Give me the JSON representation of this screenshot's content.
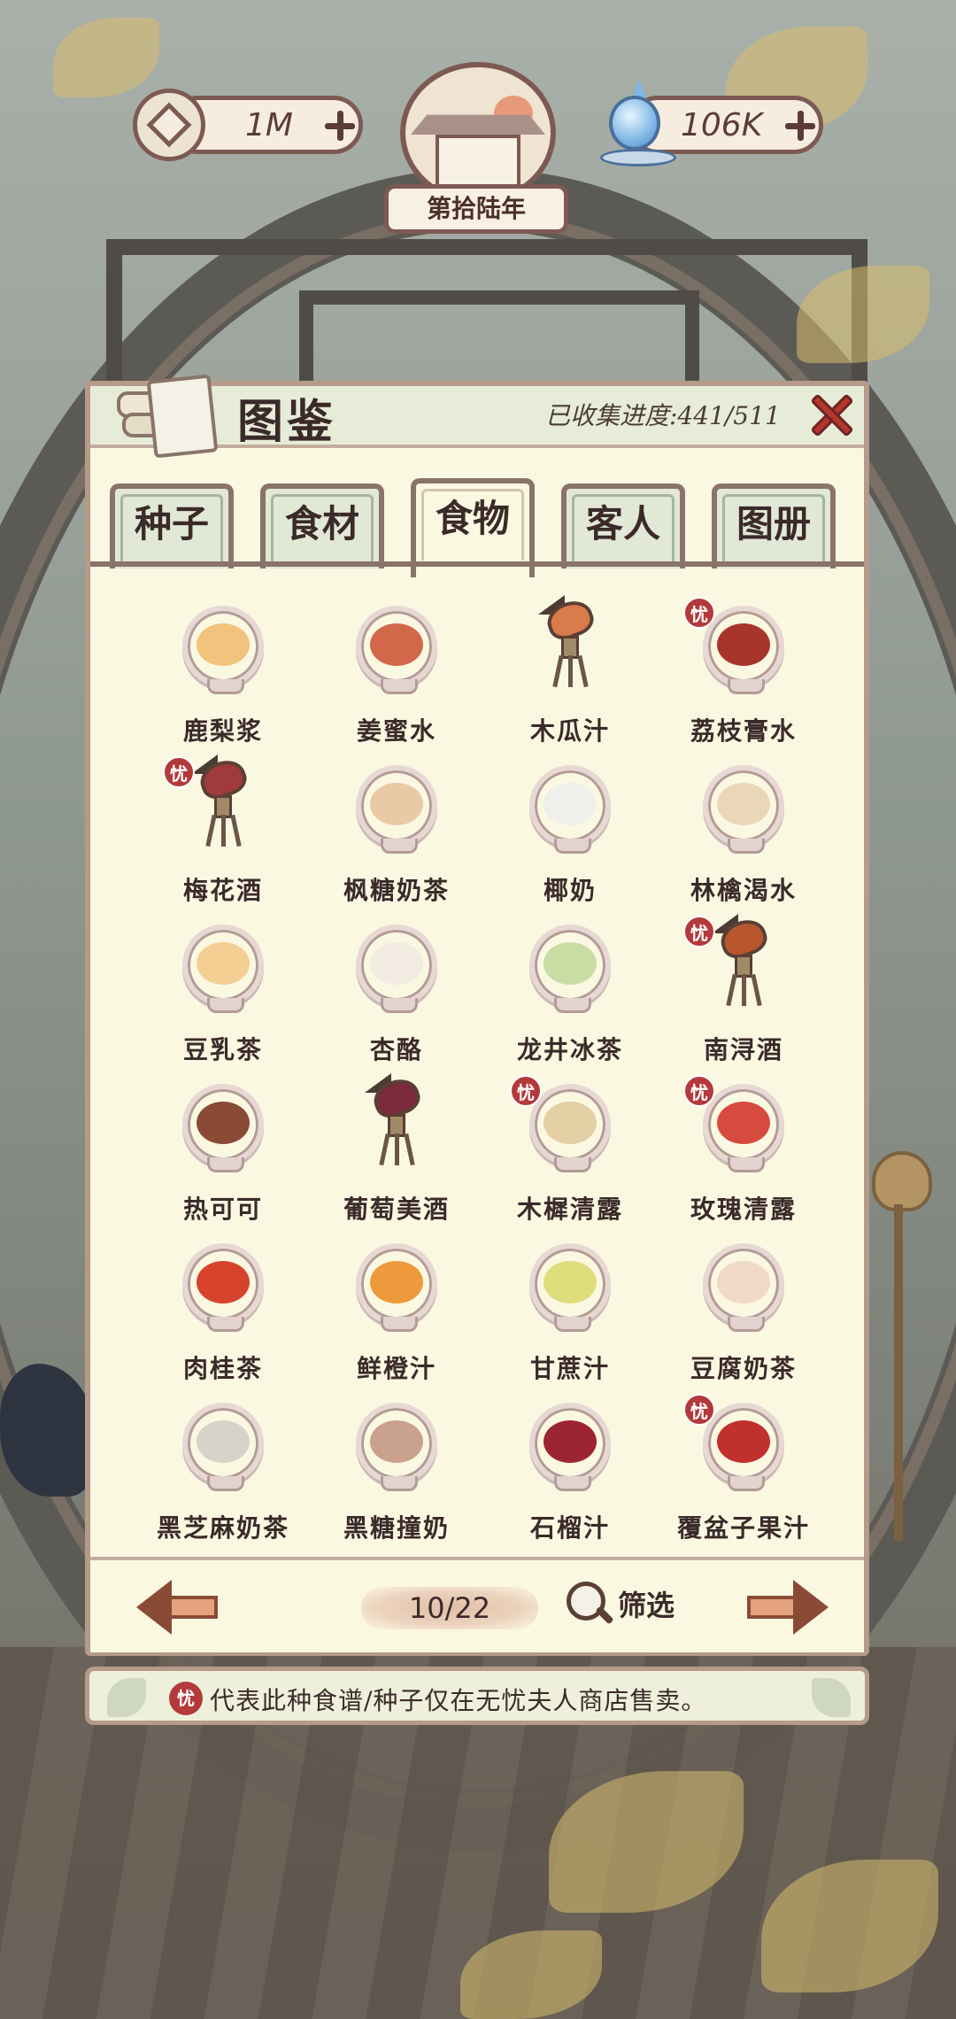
{
  "hud": {
    "coins": "1M",
    "water": "106K",
    "year": "第拾陆年"
  },
  "panel": {
    "title": "图鉴",
    "progress": "已收集进度:441/511"
  },
  "tabs": [
    {
      "label": "种子"
    },
    {
      "label": "食材"
    },
    {
      "label": "食物"
    },
    {
      "label": "客人"
    },
    {
      "label": "图册"
    }
  ],
  "active_tab": "食物",
  "items": [
    {
      "name": "鹿梨浆",
      "icon": "cup",
      "liquid": "#f2c37c",
      "exclusive": false
    },
    {
      "name": "姜蜜水",
      "icon": "cup",
      "liquid": "#d2674a",
      "exclusive": false
    },
    {
      "name": "木瓜汁",
      "icon": "jue",
      "liquid": "#d97b4a",
      "exclusive": false
    },
    {
      "name": "荔枝膏水",
      "icon": "cup",
      "liquid": "#a8352b",
      "exclusive": true
    },
    {
      "name": "梅花酒",
      "icon": "jue",
      "liquid": "#a03a3c",
      "exclusive": true
    },
    {
      "name": "枫糖奶茶",
      "icon": "cup",
      "liquid": "#e9c9a6",
      "exclusive": false
    },
    {
      "name": "椰奶",
      "icon": "cup",
      "liquid": "#eef0ec",
      "exclusive": false
    },
    {
      "name": "林檎渴水",
      "icon": "cup",
      "liquid": "#ead7b8",
      "exclusive": false
    },
    {
      "name": "豆乳茶",
      "icon": "cup",
      "liquid": "#f3cf94",
      "exclusive": false
    },
    {
      "name": "杏酪",
      "icon": "cup",
      "liquid": "#f1ebe1",
      "exclusive": false
    },
    {
      "name": "龙井冰茶",
      "icon": "cup",
      "liquid": "#c9dca4",
      "exclusive": false
    },
    {
      "name": "南浔酒",
      "icon": "jue",
      "liquid": "#b8562e",
      "exclusive": true
    },
    {
      "name": "热可可",
      "icon": "cup",
      "liquid": "#8a4a35",
      "exclusive": false
    },
    {
      "name": "葡萄美酒",
      "icon": "jue",
      "liquid": "#7a2a3a",
      "exclusive": false
    },
    {
      "name": "木樨清露",
      "icon": "cup",
      "liquid": "#e5cfa5",
      "exclusive": true
    },
    {
      "name": "玫瑰清露",
      "icon": "cup",
      "liquid": "#d64a3f",
      "exclusive": true
    },
    {
      "name": "肉桂茶",
      "icon": "cup",
      "liquid": "#d6422b",
      "exclusive": false
    },
    {
      "name": "鲜橙汁",
      "icon": "cup",
      "liquid": "#ee9a3c",
      "exclusive": false
    },
    {
      "name": "甘蔗汁",
      "icon": "cup",
      "liquid": "#dede7c",
      "exclusive": false
    },
    {
      "name": "豆腐奶茶",
      "icon": "cup",
      "liquid": "#f0d9c6",
      "exclusive": false
    },
    {
      "name": "黑芝麻奶茶",
      "icon": "cup",
      "liquid": "#d8d3c8",
      "exclusive": false
    },
    {
      "name": "黑糖撞奶",
      "icon": "cup",
      "liquid": "#c9a18c",
      "exclusive": false
    },
    {
      "name": "石榴汁",
      "icon": "cup",
      "liquid": "#9c2430",
      "exclusive": false
    },
    {
      "name": "覆盆子果汁",
      "icon": "cup",
      "liquid": "#c0302c",
      "exclusive": true
    }
  ],
  "badge_label": "忧",
  "pagination": {
    "page": "10/22",
    "filter_label": "筛选"
  },
  "note": {
    "badge": "忧",
    "text": "代表此种食谱/种子仅在无忧夫人商店售卖。"
  },
  "colors": {
    "accent_red": "#b3393a",
    "panel_bg": "#fbf8e2",
    "border": "#b69a8a"
  }
}
